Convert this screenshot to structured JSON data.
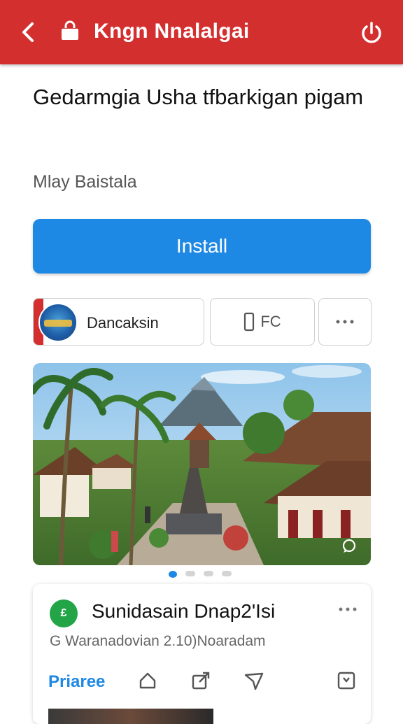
{
  "header": {
    "title": "Kngn Nnalalgai",
    "bg_color": "#d32f2f"
  },
  "app": {
    "title": "Gedarmgia Usha tfbarkigan pigam",
    "developer": "Mlay Baistala",
    "install_label": "Install",
    "accent_color": "#1e88e5"
  },
  "chips": {
    "brand_label": "Dancaksin",
    "device_label": "FC",
    "more_icon": "more-horizontal-icon"
  },
  "carousel": {
    "pages": 4,
    "active_index": 0
  },
  "review": {
    "avatar_letter": "£",
    "name": "Sunidasain Dnap2'Isi",
    "meta": "G Waranadovian  2.10)Noaradam",
    "price_label": "Priaree"
  }
}
